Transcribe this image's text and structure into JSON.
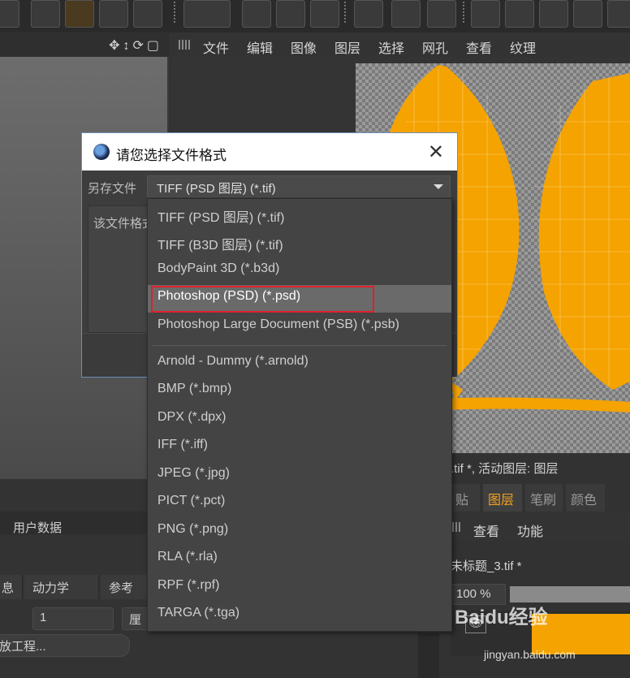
{
  "menu": {
    "items": [
      "文件",
      "编辑",
      "图像",
      "图层",
      "选择",
      "网孔",
      "查看",
      "纹理"
    ]
  },
  "left_panel": {
    "user_data_tab": "用户数据",
    "subtabs": [
      "息",
      "动力学",
      "参考"
    ],
    "field_value": "1",
    "field_btn": "厘",
    "project_btn": "放工程..."
  },
  "dialog": {
    "title": "请您选择文件格式",
    "save_as_label": "另存文件",
    "info_text": "该文件格式",
    "selected": "TIFF (PSD 图层) (*.tif)"
  },
  "dropdown": {
    "options": [
      "TIFF (PSD 图层) (*.tif)",
      "TIFF (B3D 图层) (*.tif)",
      "BodyPaint 3D (*.b3d)",
      "Photoshop (PSD) (*.psd)",
      "Photoshop Large Document (PSB) (*.psb)",
      "Arnold - Dummy (*.arnold)",
      "BMP (*.bmp)",
      "DPX (*.dpx)",
      "IFF (*.iff)",
      "JPEG (*.jpg)",
      "PICT (*.pct)",
      "PNG (*.png)",
      "RLA (*.rla)",
      "RPF (*.rpf)",
      "TARGA (*.tga)"
    ],
    "highlighted_index": 3
  },
  "right_panel": {
    "status": ".tif *, 活动图层: 图层",
    "tabs": [
      "贴图",
      "图层",
      "笔刷",
      "颜色"
    ],
    "active_tab": "图层",
    "menu": [
      "查看",
      "功能"
    ],
    "file_name": "未标题_3.tif *",
    "zoom": "100 %",
    "watermark": "Baidu经验",
    "watermark_sub": "jingyan.baidu.com"
  },
  "colors": {
    "accent": "#f0a020",
    "texture_orange": "#f5a300",
    "highlight_border": "#e0202a"
  }
}
